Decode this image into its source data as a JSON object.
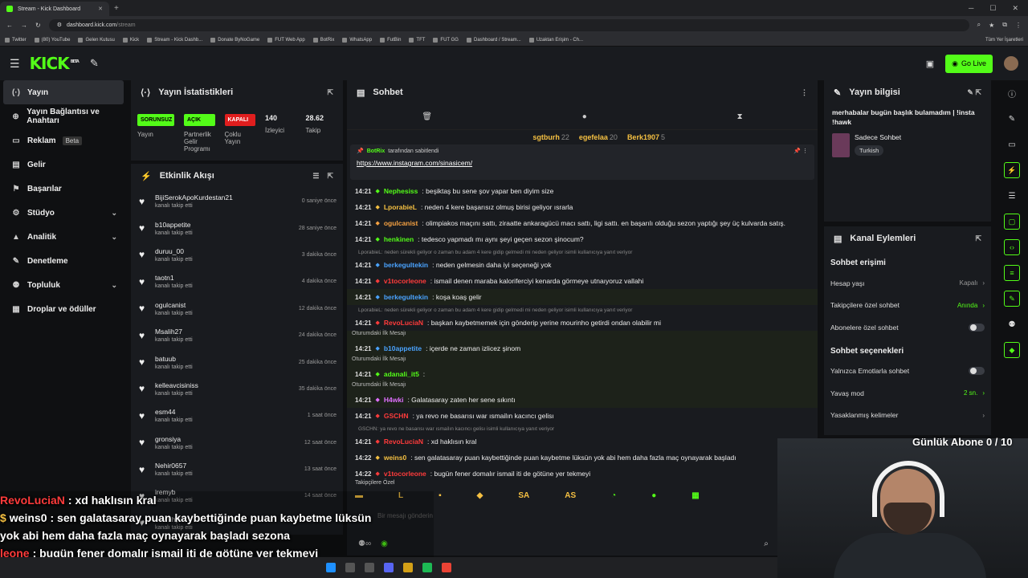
{
  "browser": {
    "tab_title": "Stream - Kick Dashboard",
    "new_tab": "+",
    "url_host": "dashboard.kick.com",
    "url_path": "/stream",
    "bookmarks": [
      "Twitter",
      "(80) YouTube",
      "Gelen Kutusu",
      "Kick",
      "Stream - Kick Dashb...",
      "Donate ByNoGame",
      "FUT Web App",
      "BotRix",
      "WhatsApp",
      "FutBin",
      "TFT",
      "FUT GG",
      "Dashboard / Stream...",
      "Uzaktan Erişim - Ch..."
    ],
    "bookmarks_right": "Tüm Yer İşaretleri"
  },
  "header": {
    "logo": "KICK",
    "logo_sup": "BETA",
    "go_live": "Go Live"
  },
  "sidebar": {
    "items": [
      {
        "label": "Yayın"
      },
      {
        "label": "Yayın Bağlantısı ve Anahtarı"
      },
      {
        "label": "Reklam",
        "badge": "Beta"
      },
      {
        "label": "Gelir"
      },
      {
        "label": "Başarılar"
      },
      {
        "label": "Stüdyo"
      },
      {
        "label": "Analitik"
      },
      {
        "label": "Denetleme"
      },
      {
        "label": "Topluluk"
      },
      {
        "label": "Droplar ve ödüller"
      }
    ]
  },
  "stats": {
    "title": "Yayın İstatistikleri",
    "cols": [
      {
        "badge": "SORUNSUZ",
        "label": "Yayın"
      },
      {
        "badge": "AÇIK",
        "label": "Partnerlik Gelir Programı"
      },
      {
        "badge": "KAPALI",
        "label": "Çoklu Yayın"
      },
      {
        "num": "140",
        "label": "İzleyici"
      },
      {
        "num": "28.62",
        "label": "Takip"
      }
    ]
  },
  "activity": {
    "title": "Etkinlik Akışı",
    "items": [
      {
        "name": "BijiSerokApoKurdestan21",
        "sub": "kanalı takip etti",
        "time": "0 saniye önce"
      },
      {
        "name": "b10appetite",
        "sub": "kanalı takip etti",
        "time": "28 saniye önce"
      },
      {
        "name": "duruu_00",
        "sub": "kanalı takip etti",
        "time": "3 dakika önce"
      },
      {
        "name": "taotn1",
        "sub": "kanalı takip etti",
        "time": "4 dakika önce"
      },
      {
        "name": "ogulcanist",
        "sub": "kanalı takip etti",
        "time": "12 dakika önce"
      },
      {
        "name": "Msalih27",
        "sub": "kanalı takip etti",
        "time": "24 dakika önce"
      },
      {
        "name": "batuub",
        "sub": "kanalı takip etti",
        "time": "25 dakika önce"
      },
      {
        "name": "kelleavcisiniss",
        "sub": "kanalı takip etti",
        "time": "35 dakika önce"
      },
      {
        "name": "esm44",
        "sub": "kanalı takip etti",
        "time": "1 saat önce"
      },
      {
        "name": "gronsiya",
        "sub": "kanalı takip etti",
        "time": "12 saat önce"
      },
      {
        "name": "Nehir0657",
        "sub": "kanalı takip etti",
        "time": "13 saat önce"
      },
      {
        "name": "iremyb",
        "sub": "kanalı takip etti",
        "time": "14 saat önce"
      },
      {
        "name": "ecemhyt",
        "sub": "kanalı takip etti",
        "time": ""
      }
    ]
  },
  "chat": {
    "title": "Sohbet",
    "leaders": [
      {
        "name": "sgtburh",
        "count": "22"
      },
      {
        "name": "egefelaa",
        "count": "20"
      },
      {
        "name": "Berk1907",
        "count": "5"
      }
    ],
    "pinned_by": "BotRix",
    "pinned_suffix": "tarafından sabitlendi",
    "pinned_link": "https://www.instagram.com/sinasicem/",
    "messages": [
      {
        "time": "14:21",
        "user": "Nephesiss",
        "text": ": beşiktaş bu sene şov yapar ben diyim size",
        "color": "#53fc18"
      },
      {
        "time": "14:21",
        "user": "LporabieL",
        "text": ": neden 4 kere başarısız olmuş birisi geliyor ısrarla",
        "color": "#f5c042"
      },
      {
        "time": "14:21",
        "user": "ogulcanist",
        "text": ": olimpiakos maçını sattı, ziraatte ankaragücü macı sattı, ligi sattı. en başarılı olduğu sezon yaptığı şey üç kulvarda satış.",
        "color": "#f5a142"
      },
      {
        "time": "14:21",
        "user": "henkinen",
        "text": ": tedesco yapmadı mı aynı şeyi geçen sezon şinocum?",
        "color": "#53fc18"
      }
    ],
    "reply1": "LporabieL: neden sürekli geliyor o zaman bu adam 4 kere gidip gelmedi mi neden geliyor isimli kullanıcıya yanıt veriyor",
    "m5": {
      "time": "14:21",
      "user": "berkegultekin",
      "text": ": neden gelmesin daha iyi seçeneği yok"
    },
    "m6": {
      "time": "14:21",
      "user": "v1tocorleone",
      "text": ": ismail denen maraba kaloriferciyi kenarda görmeye utnaıyoruz vallahi"
    },
    "m7": {
      "time": "14:21",
      "user": "berkegultekin",
      "text": ": koşa koaş gelir"
    },
    "reply2": "LporabieL: neden sürekli geliyor o zaman bu adam 4 kere gidip gelmedi mi neden geliyor isimli kullanıcıya yanıt veriyor",
    "m8": {
      "time": "14:21",
      "user": "RevoLuciaN",
      "text": ": başkan kaybetmemek için gönderip yerine mourinho getirdi ondan olabilir mi"
    },
    "first_msg": "Oturumdaki İlk Mesajı",
    "m9": {
      "time": "14:21",
      "user": "b10appetite",
      "text": ": içerde ne zaman izlicez şinom"
    },
    "m10": {
      "time": "14:21",
      "user": "adanali_it5",
      "text": ":"
    },
    "m11": {
      "time": "14:21",
      "user": "H4wki",
      "text": ": Galatasaray zaten her sene sıkıntı"
    },
    "m12": {
      "time": "14:21",
      "user": "GSCHN",
      "text": ": ya revo ne basarısı war ısmailın kacıncı gelisı"
    },
    "reply3": "GSCHN: ya revo ne basarısı war ısmailın kacıncı gelisı isimli kullanıcıya yanıt veriyor",
    "m13": {
      "time": "14:21",
      "user": "RevoLuciaN",
      "text": ": xd haklısın kral"
    },
    "m14": {
      "time": "14:22",
      "user": "weins0",
      "text": ": sen galatasaray puan kaybettiğinde puan kaybetme lüksün yok abi hem daha fazla maç oynayarak başladı"
    },
    "m15": {
      "time": "14:22",
      "user": "v1tocorleone",
      "text": ": bugün fener domalır ismail iti de götüne yer tekmeyi"
    },
    "follow_only": "Takipçilere Özel",
    "emotes": [
      "SA",
      "AS"
    ],
    "input_placeholder": "Bir mesajı gönderin"
  },
  "info": {
    "title": "Yayın bilgisi",
    "stream_title": "merhabalar bugün başlık bulamadım | !insta !hawk",
    "category": "Sadece Sohbet",
    "tag": "Turkish"
  },
  "actions": {
    "title": "Kanal Eylemleri",
    "section1": "Sohbet erişimi",
    "rows1": [
      {
        "label": "Hesap yaşı",
        "value": "Kapalı"
      },
      {
        "label": "Takipçilere özel sohbet",
        "value": "Anında"
      },
      {
        "label": "Abonelere özel sohbet",
        "value": ""
      }
    ],
    "section2": "Sohbet seçenekleri",
    "rows2": [
      {
        "label": "Yalnızca Emotlarla sohbet",
        "value": ""
      },
      {
        "label": "Yavaş mod",
        "value": "2 sn."
      },
      {
        "label": "Yasaklanmış kelimeler",
        "value": ""
      }
    ]
  },
  "overlay": {
    "sub_goal": "Günlük Abone 0 / 10",
    "lines": [
      {
        "user": "RevoLuciaN",
        "text": ": xd haklısın kral"
      },
      {
        "user": "weins0",
        "text": ": sen galatasaray puan kaybettiğinde puan kaybetme lüksün"
      },
      {
        "user": "",
        "text": "yok abi hem daha fazla maç oynayarak başladı sezona"
      },
      {
        "user": "leone",
        "text": ": bugün fener domalır ismail iti de götüne yer tekmeyi"
      }
    ]
  },
  "colors": {
    "accent": "#53fc18",
    "danger": "#e01e1e",
    "panel": "#191b1f"
  }
}
